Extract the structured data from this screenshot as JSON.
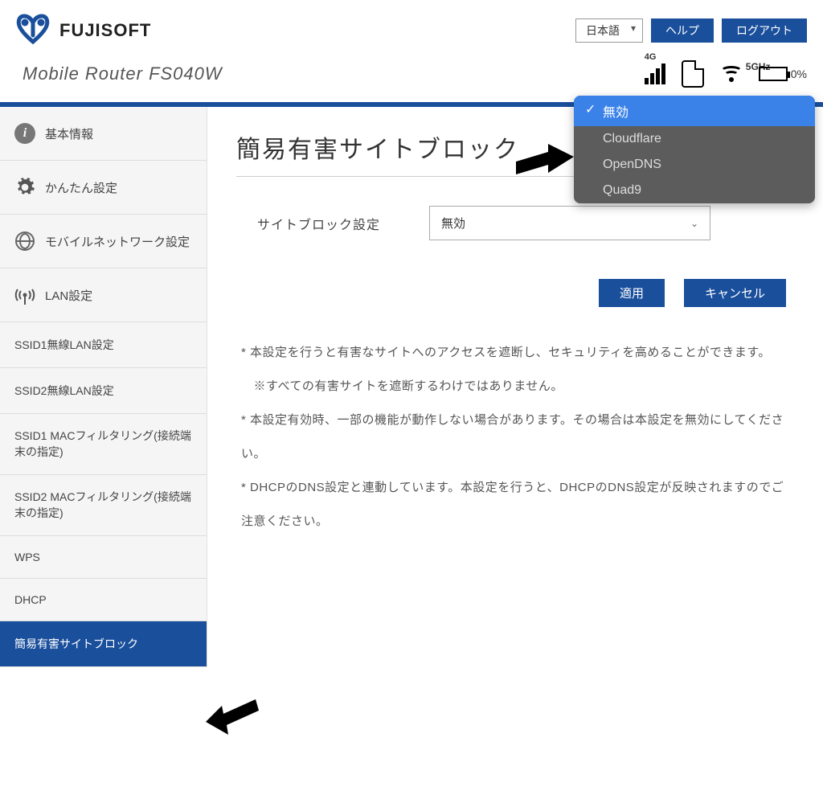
{
  "brand": "FUJISOFT",
  "device": "Mobile Router FS040W",
  "topbar": {
    "language": "日本語",
    "help": "ヘルプ",
    "logout": "ログアウト"
  },
  "status": {
    "network_type": "4G",
    "wifi_band": "5GHz",
    "battery_pct": "0%"
  },
  "sidebar": {
    "items": [
      {
        "label": "基本情報"
      },
      {
        "label": "かんたん設定"
      },
      {
        "label": "モバイルネットワーク設定"
      },
      {
        "label": "LAN設定"
      },
      {
        "label": "SSID1無線LAN設定"
      },
      {
        "label": "SSID2無線LAN設定"
      },
      {
        "label": "SSID1 MACフィルタリング(接続端末の指定)"
      },
      {
        "label": "SSID2 MACフィルタリング(接続端末の指定)"
      },
      {
        "label": "WPS"
      },
      {
        "label": "DHCP"
      },
      {
        "label": "簡易有害サイトブロック"
      }
    ]
  },
  "page": {
    "title": "簡易有害サイトブロック",
    "field_label": "サイトブロック設定",
    "selected_value": "無効",
    "apply": "適用",
    "cancel": "キャンセル",
    "notes": [
      "* 本設定を行うと有害なサイトへのアクセスを遮断し、セキュリティを高めることができます。",
      "　※すべての有害サイトを遮断するわけではありません。",
      "* 本設定有効時、一部の機能が動作しない場合があります。その場合は本設定を無効にしてください。",
      "* DHCPのDNS設定と連動しています。本設定を行うと、DHCPのDNS設定が反映されますのでご注意ください。"
    ]
  },
  "dropdown": {
    "options": [
      "無効",
      "Cloudflare",
      "OpenDNS",
      "Quad9"
    ],
    "selected_index": 0
  }
}
